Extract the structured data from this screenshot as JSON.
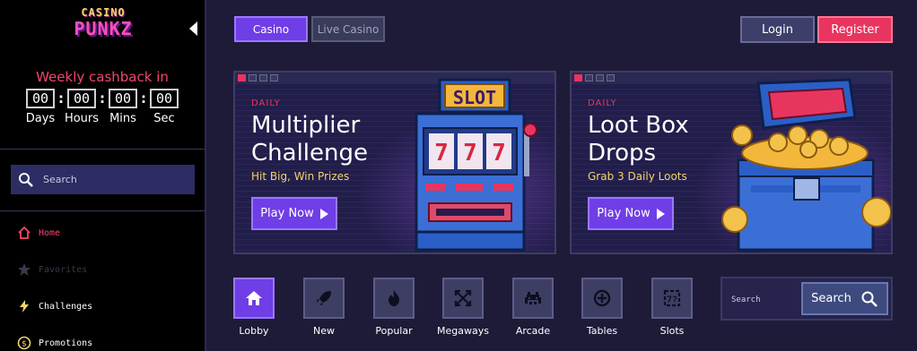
{
  "brand": {
    "line1": "CASINO",
    "line2": "PUNKZ"
  },
  "cashback": {
    "title": "Weekly cashback in",
    "units": [
      {
        "value": "00",
        "label": "Days"
      },
      {
        "value": "00",
        "label": "Hours"
      },
      {
        "value": "00",
        "label": "Mins"
      },
      {
        "value": "00",
        "label": "Sec"
      }
    ],
    "separator": ":"
  },
  "sidebar": {
    "search_placeholder": "Search",
    "nav": [
      {
        "label": "Home",
        "color": "#f5456e",
        "icon": "home-icon"
      },
      {
        "label": "Favorites",
        "color": "#3a3a4a",
        "icon": "star-icon"
      },
      {
        "label": "Challenges",
        "color": "#ffffff",
        "icon": "lightning-icon"
      },
      {
        "label": "Promotions",
        "color": "#ffffff",
        "icon": "dollar-coin-icon"
      }
    ]
  },
  "header": {
    "tabs": [
      {
        "label": "Casino",
        "active": true
      },
      {
        "label": "Live Casino",
        "active": false
      }
    ],
    "login": "Login",
    "register": "Register"
  },
  "promos": [
    {
      "kicker": "DAILY",
      "title_line1": "Multiplier",
      "title_line2": "Challenge",
      "subtitle": "Hit Big, Win Prizes",
      "cta": "Play Now",
      "art": "slot-machine",
      "art_text": "SLOT",
      "reels": "777"
    },
    {
      "kicker": "DAILY",
      "title_line1": "Loot Box",
      "title_line2": "Drops",
      "subtitle": "Grab 3 Daily Loots",
      "cta": "Play Now",
      "art": "treasure-chest"
    }
  ],
  "categories": [
    {
      "label": "Lobby",
      "icon": "home-icon",
      "active": true
    },
    {
      "label": "New",
      "icon": "rocket-icon",
      "active": false
    },
    {
      "label": "Popular",
      "icon": "fire-icon",
      "active": false
    },
    {
      "label": "Megaways",
      "icon": "arrows-out-icon",
      "active": false
    },
    {
      "label": "Arcade",
      "icon": "space-invader-icon",
      "active": false
    },
    {
      "label": "Tables",
      "icon": "poker-chip-icon",
      "active": false
    },
    {
      "label": "Slots",
      "icon": "slot-reel-icon",
      "active": false
    }
  ],
  "game_search": {
    "placeholder": "Search",
    "button": "Search"
  },
  "colors": {
    "accent_purple": "#6f3ee6",
    "accent_red": "#e8355f",
    "gold": "#f3d36b",
    "background": "#1d1b38"
  }
}
